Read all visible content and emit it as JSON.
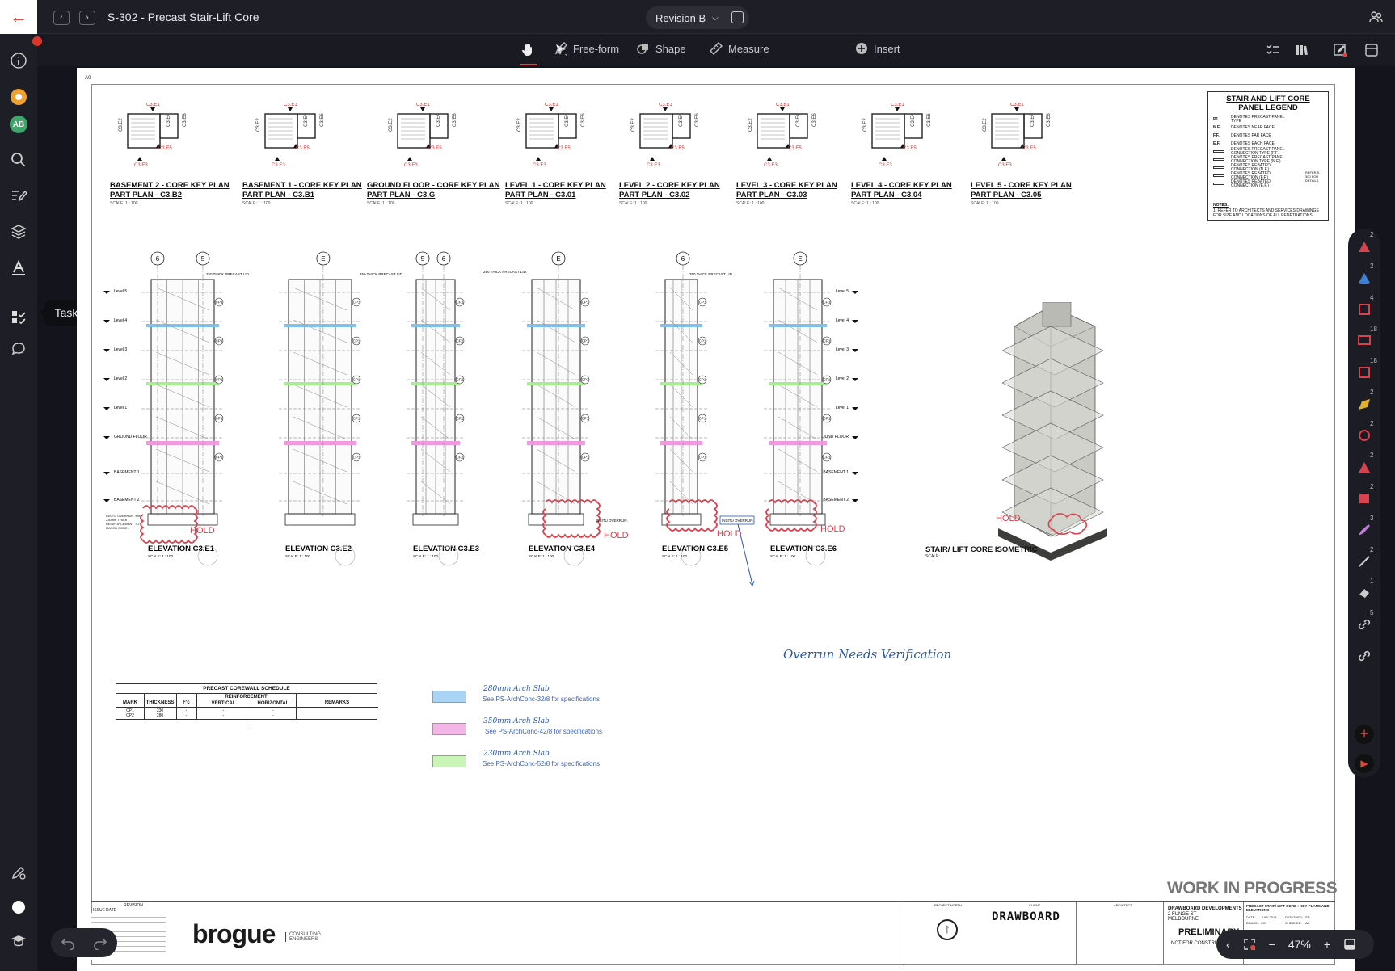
{
  "app": {
    "doc_title": "S-302 - Precast Stair-Lift Core",
    "revision": "Revision B",
    "tooltip": "Tasks"
  },
  "toolbar": {
    "freeform": "Free-form",
    "shape": "Shape",
    "measure": "Measure",
    "insert": "Insert"
  },
  "sidebar": {
    "avatar": "AB"
  },
  "sheet": {
    "corner_label": "A0",
    "legend": {
      "title": "STAIR AND LIFT CORE PANEL LEGEND",
      "rows": [
        {
          "sym": "P1",
          "text": "DENOTES PRECAST PANEL TYPE"
        },
        {
          "sym": "N.F.",
          "text": "DENOTES NEAR FACE"
        },
        {
          "sym": "F.F.",
          "text": "DENOTES FAR FACE"
        },
        {
          "sym": "E.F.",
          "text": "DENOTES EACH FACE"
        },
        {
          "sym": "",
          "text": "DENOTES PRECAST PANEL CONNECTION TYPE (F.F.)"
        },
        {
          "sym": "",
          "text": "DENOTES PRECAST PANEL CONNECTION TYPE (N.F.)"
        },
        {
          "sym": "",
          "text": "DENOTES REBATED CONNECTION (N.F.)"
        },
        {
          "sym": "",
          "text": "DENOTES REBATED CONNECTION (F.F.)"
        },
        {
          "sym": "",
          "text": "DENOTES REBATED CONNECTION (E.F.)"
        }
      ],
      "side": "REFER S-300 FOR DETAILS",
      "notes_label": "NOTES:",
      "note": "1.  REFER TO ARCHITECTS AND SERVICES DRAWINGS FOR SIZE AND LOCATIONS OF ALL PENETRATIONS"
    },
    "plans": [
      {
        "t1": "BASEMENT 2 - CORE KEY PLAN",
        "t2": "PART PLAN - C3.B2",
        "scale": "SCALE:      1 : 100"
      },
      {
        "t1": "BASEMENT 1 - CORE KEY PLAN",
        "t2": "PART PLAN - C3.B1",
        "scale": "SCALE:      1 : 100"
      },
      {
        "t1": "GROUND FLOOR - CORE KEY PLAN",
        "t2": "PART PLAN - C3.G",
        "scale": "SCALE:      1 : 100"
      },
      {
        "t1": "LEVEL 1 - CORE KEY PLAN",
        "t2": "PART PLAN - C3.01",
        "scale": "SCALE:      1 : 100"
      },
      {
        "t1": "LEVEL 2 - CORE KEY PLAN",
        "t2": "PART PLAN - C3.02",
        "scale": "SCALE:      1 : 100"
      },
      {
        "t1": "LEVEL 3 - CORE KEY PLAN",
        "t2": "PART PLAN - C3.03",
        "scale": "SCALE:      1 : 100"
      },
      {
        "t1": "LEVEL 4 - CORE KEY PLAN",
        "t2": "PART PLAN - C3.04",
        "scale": "SCALE:      1 : 100"
      },
      {
        "t1": "LEVEL 5 - CORE KEY PLAN",
        "t2": "PART PLAN - C3.05",
        "scale": "SCALE:      1 : 100"
      }
    ],
    "plan_marks": {
      "e1": "C3.E1",
      "e2": "C3.E2",
      "e3": "C3.E3",
      "e4": "C3.E4",
      "e5": "C3.E5",
      "e6": "C3.E6"
    },
    "levels": [
      "Level 5",
      "Level 4",
      "Level 3",
      "Level 2",
      "Level 1",
      "GROUND FLOOR",
      "BASEMENT 1",
      "BASEMENT 2"
    ],
    "elevations": [
      {
        "t": "ELEVATION   C3.E1",
        "grids": [
          "6",
          "5"
        ]
      },
      {
        "t": "ELEVATION   C3.E2",
        "grids": [
          "E"
        ]
      },
      {
        "t": "ELEVATION   C3.E3",
        "grids": [
          "5",
          "6"
        ]
      },
      {
        "t": "ELEVATION   C3.E4",
        "grids": [
          "E"
        ]
      },
      {
        "t": "ELEVATION   C3.E5",
        "grids": [
          "6"
        ]
      },
      {
        "t": "ELEVATION   C3.E6",
        "grids": [
          "E"
        ]
      }
    ],
    "elev_scale": "SCALE:     1 : 100",
    "lid_note": "250 THICK PRECAST LID.",
    "cp": "CP1",
    "overrun_note": "INSITU OVERRUN. MIN 230mm THICK REINFORCEMENT TO MATCH CORE.",
    "insitu_label": "INSITU OVERRUN.",
    "hold": "HOLD",
    "iso_title": "STAIR/ LIFT CORE ISOMETRIC",
    "iso_scale": "SCALE:",
    "annotation": "Overrun Needs Verification",
    "schedule": {
      "title": "PRECAST COREWALL SCHEDULE",
      "headers": [
        "MARK",
        "THICKNESS",
        "F'c",
        "REINFORCEMENT",
        "REMARKS"
      ],
      "subheaders": [
        "VERTICAL",
        "HORIZONTAL"
      ],
      "rows": [
        [
          "CP1",
          "230",
          "-",
          "-",
          "-"
        ],
        [
          "CP2",
          "280",
          "-",
          "-",
          "-"
        ]
      ]
    },
    "slab_legend": [
      {
        "hw": "280mm Arch Slab",
        "ref": "See PS-ArchConc-32/8 for specifications",
        "color": "#a9d4f5"
      },
      {
        "hw": "350mm Arch Slab",
        "ref": "See PS-ArchConc-42/8 for specifications",
        "color": "#f4b6e6"
      },
      {
        "hw": "230mm Arch Slab",
        "ref": "See PS-ArchConc-52/8 for specifications",
        "color": "#c9f5b6"
      }
    ],
    "wip": "WORK IN PROGRESS",
    "titleblock": {
      "revision": "REVISION",
      "issue": "ISSUE",
      "date": "DATE",
      "firm": "brogue",
      "firm_sub": "CONSULTING ENGINEERS",
      "project_north": "PROJECT NORTH",
      "client": "CLIENT",
      "client_logo": "DRAWBOARD",
      "architect": "ARCHITECT",
      "address1": "DRAWBOARD DEVELOPMENTS",
      "address2": "2 FUNGE ST",
      "address3": "MELBOURNE",
      "prelim": "PRELIMINARY",
      "not_for": "NOT FOR CONSTRUCTION",
      "dtitle": "PRECAST STAIR/ LIFT CORE : KEY PLANS AND ELEVATIONS",
      "date_l": "DATE:",
      "date_v": "JULY 2016",
      "designed": "DESIGNED:",
      "designed_v": "SD",
      "drawn": "DRAWN:",
      "drawn_v": "CC",
      "checked": "CHECKED:",
      "checked_v": "AA"
    }
  },
  "zoom": {
    "level": "47%"
  },
  "rightbar": {
    "counts": [
      "2",
      "2",
      "4",
      "18",
      "18",
      "2",
      "2",
      "2",
      "2",
      "3",
      "2",
      "1",
      "5"
    ]
  }
}
